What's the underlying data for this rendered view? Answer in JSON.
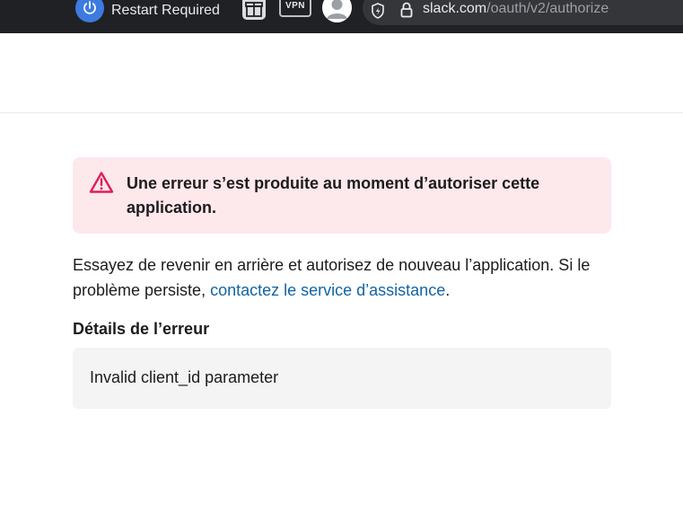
{
  "browser": {
    "restart_label": "Restart Required",
    "vpn_label": "VPN",
    "url_host": "slack.com",
    "url_path": "/oauth/v2/authorize",
    "icons": [
      "power-icon",
      "gift-icon",
      "vpn-icon",
      "profile-avatar",
      "shield-icon",
      "lock-icon"
    ]
  },
  "error": {
    "title": "Une erreur s’est produite au moment d’autoriser cette application.",
    "icon": "warning-triangle-icon",
    "accent_color": "#e01e5a",
    "background_color": "#fde8ec"
  },
  "body": {
    "message_prefix": "Essayez de revenir en arrière et autorisez de nouveau l’application. Si le problème persiste, ",
    "support_link": "contactez le service d’assistance",
    "message_suffix": ".",
    "link_color": "#1264a3"
  },
  "details": {
    "heading": "Détails de l’erreur",
    "text": "Invalid client_id parameter"
  }
}
